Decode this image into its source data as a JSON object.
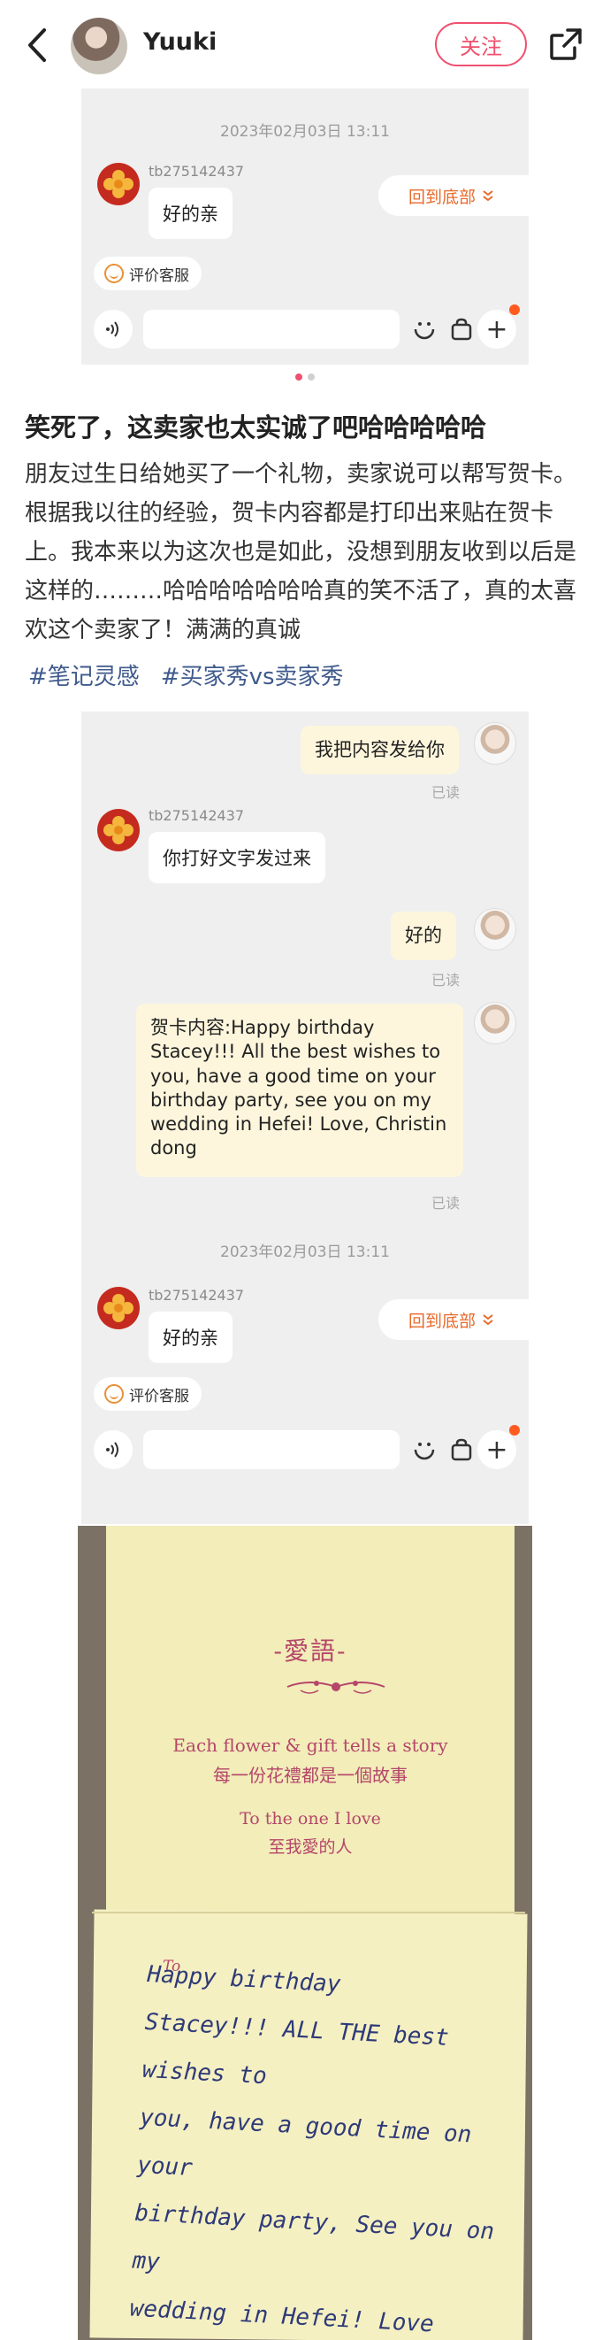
{
  "header": {
    "username": "Yuuki",
    "follow_label": "关注"
  },
  "chat1": {
    "timestamp": "2023年02月03日 13:11",
    "shop_name": "tb275142437",
    "message": "好的亲",
    "scroll_bottom_label": "回到底部",
    "rate_label": "评价客服"
  },
  "carousel": {
    "pages": 2,
    "active": 1
  },
  "post": {
    "title": "笑死了，这卖家也太实诚了吧哈哈哈哈哈",
    "body": "朋友过生日给她买了一个礼物，卖家说可以帮写贺卡。根据我以往的经验，贺卡内容都是打印出来贴在贺卡上。我本来以为这次也是如此，没想到朋友收到以后是这样的………哈哈哈哈哈哈哈真的笑不活了，真的太喜欢这个卖家了！满满的真诚",
    "tags": [
      "#笔记灵感",
      "#买家秀vs卖家秀"
    ]
  },
  "chat2": {
    "messages": [
      {
        "side": "right",
        "text": "我把内容发给你",
        "status": "已读"
      },
      {
        "side": "left",
        "shop_name": "tb275142437",
        "text": "你打好文字发过来"
      },
      {
        "side": "right",
        "text": "好的",
        "status": "已读"
      },
      {
        "side": "right",
        "text": "贺卡内容:Happy birthday Stacey!!! All the best wishes to you, have a good time on your birthday party, see you on my wedding in Hefei! Love, Christin dong",
        "status": "已读"
      }
    ],
    "timestamp": "2023年02月03日 13:11",
    "shop_name": "tb275142437",
    "final_message": "好的亲",
    "scroll_bottom_label": "回到底部",
    "rate_label": "评价客服"
  },
  "card": {
    "title": "-愛語-",
    "line1": "Each flower & gift tells a story",
    "line2": "每一份花禮都是一個故事",
    "line3": "To the one I love",
    "line4": "至我愛的人",
    "to_label": "To",
    "handwriting": "Happy birthday\nStacey!!! ALL THE best wishes to\nyou, have a good time on your\nbirthday party, See you on my\nwedding in Hefei! Love Christin\ndong"
  },
  "colors": {
    "accent": "#f0506e",
    "link": "#3f5a8c",
    "chat_bg": "#efefef",
    "orange": "#e86a2b"
  }
}
